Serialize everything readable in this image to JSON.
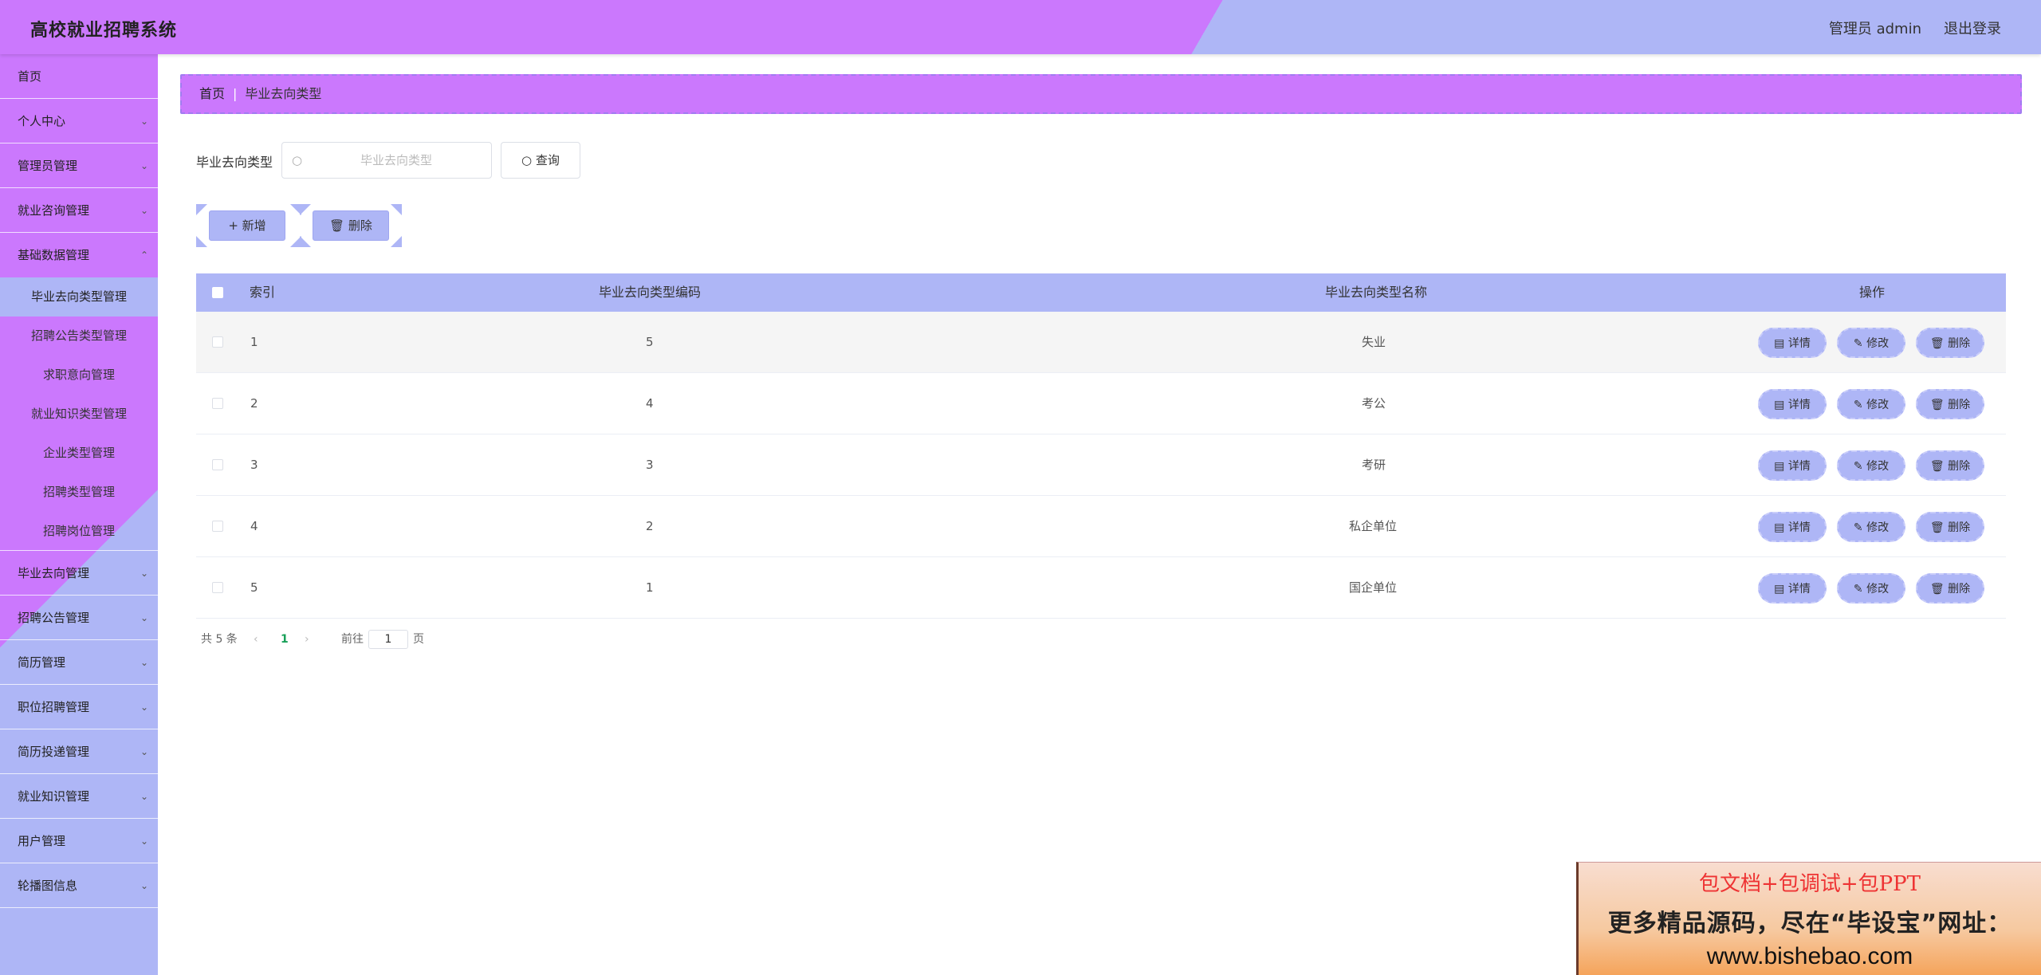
{
  "header": {
    "title": "高校就业招聘系统",
    "admin_label": "管理员 admin",
    "logout_label": "退出登录"
  },
  "sidebar": {
    "home": "首页",
    "menus_top": [
      "个人中心",
      "管理员管理",
      "就业咨询管理",
      "基础数据管理"
    ],
    "submenu": [
      {
        "label": "毕业去向类型管理",
        "active": true
      },
      {
        "label": "招聘公告类型管理",
        "active": false
      },
      {
        "label": "求职意向管理",
        "active": false
      },
      {
        "label": "就业知识类型管理",
        "active": false
      },
      {
        "label": "企业类型管理",
        "active": false
      },
      {
        "label": "招聘类型管理",
        "active": false
      },
      {
        "label": "招聘岗位管理",
        "active": false
      }
    ],
    "menus_bottom": [
      "毕业去向管理",
      "招聘公告管理",
      "简历管理",
      "职位招聘管理",
      "简历投递管理",
      "就业知识管理",
      "用户管理",
      "轮播图信息"
    ]
  },
  "breadcrumb": {
    "home": "首页",
    "separator": "|",
    "current": "毕业去向类型"
  },
  "search": {
    "label": "毕业去向类型",
    "placeholder": "毕业去向类型",
    "value": "",
    "query_label": "查询"
  },
  "toolbar": {
    "add_label": "新增",
    "delete_label": "删除"
  },
  "table": {
    "headers": {
      "index": "索引",
      "code": "毕业去向类型编码",
      "name": "毕业去向类型名称",
      "ops": "操作"
    },
    "rows": [
      {
        "index": "1",
        "code": "5",
        "name": "失业"
      },
      {
        "index": "2",
        "code": "4",
        "name": "考公"
      },
      {
        "index": "3",
        "code": "3",
        "name": "考研"
      },
      {
        "index": "4",
        "code": "2",
        "name": "私企单位"
      },
      {
        "index": "5",
        "code": "1",
        "name": "国企单位"
      }
    ],
    "row_actions": {
      "detail": "详情",
      "edit": "修改",
      "delete": "删除"
    }
  },
  "pagination": {
    "total_text": "共 5 条",
    "prev": "‹",
    "current_page": "1",
    "next": "›",
    "goto_label": "前往",
    "goto_value": "1",
    "page_suffix": "页"
  },
  "watermark": {
    "line1": "包文档+包调试+包PPT",
    "line2": "更多精品源码，尽在“毕设宝”网址：",
    "line3": "www.bishebao.com"
  },
  "colors": {
    "header_purple": "#cb78fd",
    "accent_blue": "#aeb6f6",
    "active_page": "#18a058"
  }
}
